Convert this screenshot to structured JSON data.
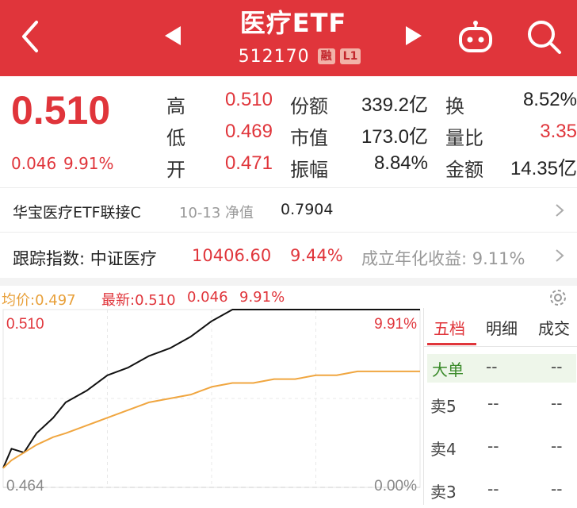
{
  "header": {
    "title": "医疗ETF",
    "code": "512170",
    "tag_margin": "融",
    "tag_level": "L1",
    "bg_color": "#e0353b"
  },
  "icons": {
    "back": "back-arrow-icon",
    "prev": "left-triangle-icon",
    "next": "right-triangle-icon",
    "robot": "robot-icon",
    "search": "search-icon",
    "settings": "gear-icon",
    "chevron": "chevron-right-icon"
  },
  "quote": {
    "price": "0.510",
    "change": "0.046",
    "change_pct": "9.91%",
    "rows": [
      {
        "l1": "高",
        "v1": "0.510",
        "l2": "份额",
        "v2": "339.2亿",
        "l3": "换",
        "v3": "8.52%"
      },
      {
        "l1": "低",
        "v1": "0.469",
        "l2": "市值",
        "v2": "173.0亿",
        "l3": "量比",
        "v3": "3.35"
      },
      {
        "l1": "开",
        "v1": "0.471",
        "l2": "振幅",
        "v2": "8.84%",
        "l3": "金额",
        "v3": "14.35亿"
      }
    ]
  },
  "linked_fund": {
    "name": "华宝医疗ETF联接C",
    "date_label": "10-13 净值",
    "nav": "0.7904"
  },
  "tracking": {
    "label": "跟踪指数: 中证医疗",
    "value": "10406.60",
    "pct": "9.44%",
    "annual_label": "成立年化收益: 9.11%"
  },
  "chart_header": {
    "avg_label": "均价:0.497",
    "latest_label": "最新:0.510",
    "latest_change": "0.046",
    "latest_pct": "9.91%"
  },
  "chart_data": {
    "type": "line",
    "y_top_label": "0.510",
    "y_bottom_label": "0.464",
    "pct_top_label": "9.91%",
    "pct_bottom_label": "0.00%",
    "ylim": [
      0.464,
      0.51
    ],
    "x": [
      0,
      0.02,
      0.05,
      0.08,
      0.1,
      0.12,
      0.15,
      0.2,
      0.25,
      0.3,
      0.35,
      0.4,
      0.45,
      0.5,
      0.55,
      0.6,
      0.65,
      0.7,
      0.75,
      0.8,
      0.85,
      0.9,
      0.95,
      1.0
    ],
    "series": [
      {
        "color": "#111111",
        "values": [
          0.469,
          0.474,
          0.473,
          0.478,
          0.48,
          0.482,
          0.486,
          0.489,
          0.493,
          0.495,
          0.498,
          0.5,
          0.503,
          0.507,
          0.51,
          0.51,
          0.51,
          0.51,
          0.51,
          0.51,
          0.51,
          0.51,
          0.51,
          0.51
        ]
      },
      {
        "color": "#f0a640",
        "values": [
          0.469,
          0.471,
          0.473,
          0.475,
          0.476,
          0.477,
          0.478,
          0.48,
          0.482,
          0.484,
          0.486,
          0.487,
          0.488,
          0.49,
          0.491,
          0.491,
          0.492,
          0.492,
          0.493,
          0.493,
          0.494,
          0.494,
          0.494,
          0.494
        ]
      }
    ],
    "grid": true
  },
  "panel": {
    "tabs": [
      "五档",
      "明细",
      "成交"
    ],
    "big_order": {
      "label": "大单",
      "a": "--",
      "b": "--"
    },
    "book": [
      {
        "label": "卖5",
        "a": "--",
        "b": "--"
      },
      {
        "label": "卖4",
        "a": "--",
        "b": "--"
      },
      {
        "label": "卖3",
        "a": "--",
        "b": "--"
      }
    ]
  }
}
